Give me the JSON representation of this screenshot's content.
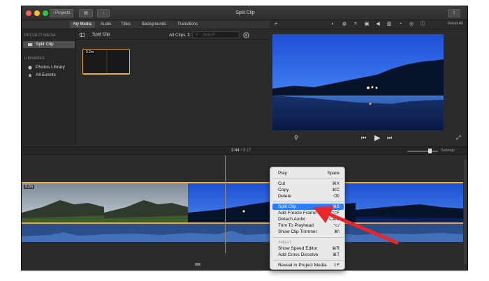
{
  "window": {
    "title": "Split Clip",
    "projects_button": "Projects"
  },
  "tabs": [
    {
      "label": "My Media",
      "active": true
    },
    {
      "label": "Audio",
      "active": false
    },
    {
      "label": "Titles",
      "active": false
    },
    {
      "label": "Backgrounds",
      "active": false
    },
    {
      "label": "Transitions",
      "active": false
    }
  ],
  "sidebar": {
    "project_media_heading": "PROJECT MEDIA",
    "project_item": "Split Clip",
    "libraries_heading": "LIBRARIES",
    "items": [
      {
        "label": "Photos Library"
      },
      {
        "label": "All Events"
      }
    ]
  },
  "browser": {
    "title": "Split Clip",
    "filter": "All Clips",
    "search_placeholder": "Search",
    "thumb_duration": "9.2m"
  },
  "viewer": {
    "reset_label": "Reset All"
  },
  "timeline": {
    "current_time": "3:44",
    "total_time": "9:17",
    "settings_label": "Settings",
    "clip_duration": "9.2m"
  },
  "context_menu": {
    "groups": [
      [
        {
          "label": "Play",
          "shortcut": "Space",
          "state": "normal"
        }
      ],
      [
        {
          "label": "Cut",
          "shortcut": "⌘X",
          "state": "normal"
        },
        {
          "label": "Copy",
          "shortcut": "⌘C",
          "state": "normal"
        },
        {
          "label": "Delete",
          "shortcut": "⌫",
          "state": "normal"
        }
      ],
      [
        {
          "label": "Split Clip",
          "shortcut": "⌘B",
          "state": "highlighted"
        },
        {
          "label": "Add Freeze Frame",
          "shortcut": "⌥F",
          "state": "normal"
        },
        {
          "label": "Detach Audio",
          "shortcut": "⌥⌘B",
          "state": "normal"
        },
        {
          "label": "Trim To Playhead",
          "shortcut": "⌥/",
          "state": "normal"
        },
        {
          "label": "Show Clip Trimmer",
          "shortcut": "⌘\\",
          "state": "normal"
        }
      ],
      [
        {
          "label": "Adjust",
          "shortcut": "",
          "state": "disabled"
        },
        {
          "label": "Show Speed Editor",
          "shortcut": "⌘R",
          "state": "normal"
        },
        {
          "label": "Add Cross Dissolve",
          "shortcut": "⌘T",
          "state": "normal"
        }
      ],
      [
        {
          "label": "Reveal in Project Media",
          "shortcut": "⇧F",
          "state": "normal"
        }
      ]
    ]
  },
  "colors": {
    "accent_highlight": "#2e7df6",
    "clip_border": "#e8b04a",
    "annotation_arrow": "#e8262b"
  }
}
